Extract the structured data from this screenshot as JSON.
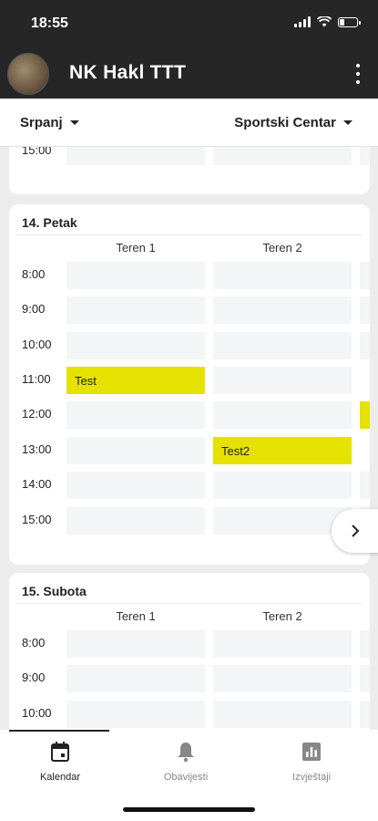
{
  "status": {
    "time": "18:55"
  },
  "header": {
    "title": "NK Hakl TTT"
  },
  "filters": {
    "month": "Srpanj",
    "venue": "Sportski Centar"
  },
  "prev_day": {
    "time_label": "15:00"
  },
  "days": [
    {
      "title": "14. Petak",
      "courts": [
        "Teren 1",
        "Teren 2"
      ],
      "times": [
        "8:00",
        "9:00",
        "10:00",
        "11:00",
        "12:00",
        "13:00",
        "14:00",
        "15:00"
      ],
      "bookings": [
        {
          "court": "Teren 1",
          "time": "11:00",
          "label": "Test"
        },
        {
          "court": "Teren 2",
          "time": "13:00",
          "label": "Test2"
        }
      ]
    },
    {
      "title": "15. Subota",
      "courts": [
        "Teren 1",
        "Teren 2"
      ],
      "times": [
        "8:00",
        "9:00",
        "10:00"
      ]
    }
  ],
  "nav": {
    "calendar": "Kalendar",
    "notifications": "Obavijesti",
    "reports": "Izvještaji"
  },
  "colors": {
    "booking": "#e5e100",
    "topbar": "#262626",
    "slot": "#f3f5f7"
  },
  "icons": [
    "signal-icon",
    "wifi-icon",
    "battery-icon",
    "more-vert-icon",
    "caret-down-icon",
    "chevron-right-icon",
    "calendar-icon",
    "bell-icon",
    "bar-chart-icon"
  ]
}
